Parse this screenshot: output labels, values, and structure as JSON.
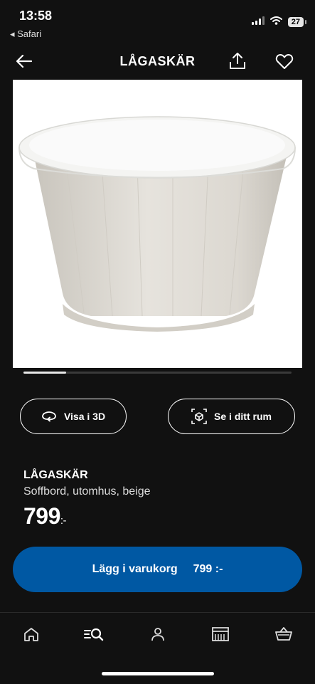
{
  "status_bar": {
    "time": "13:58",
    "back_app": "◂ Safari",
    "battery": "27",
    "icons": [
      "signal-icon",
      "wifi-icon",
      "battery-icon"
    ]
  },
  "nav": {
    "title": "LÅGASKÄR",
    "back_icon": "arrow-left-icon",
    "share_icon": "share-icon",
    "favorite_icon": "heart-icon"
  },
  "gallery": {
    "progress": 0.16
  },
  "actions": {
    "view_3d_label": "Visa i 3D",
    "view_room_label": "Se i ditt rum"
  },
  "product": {
    "name": "LÅGASKÄR",
    "description": "Soffbord, utomhus, beige",
    "price": "799",
    "price_suffix": ":-"
  },
  "cart": {
    "label": "Lägg i varukorg",
    "price": "799 :-"
  },
  "tabs": [
    {
      "name": "home-icon"
    },
    {
      "name": "search-icon"
    },
    {
      "name": "profile-icon"
    },
    {
      "name": "store-icon"
    },
    {
      "name": "basket-icon"
    }
  ],
  "colors": {
    "background": "#111111",
    "accent": "#0058a3",
    "text": "#ffffff"
  }
}
